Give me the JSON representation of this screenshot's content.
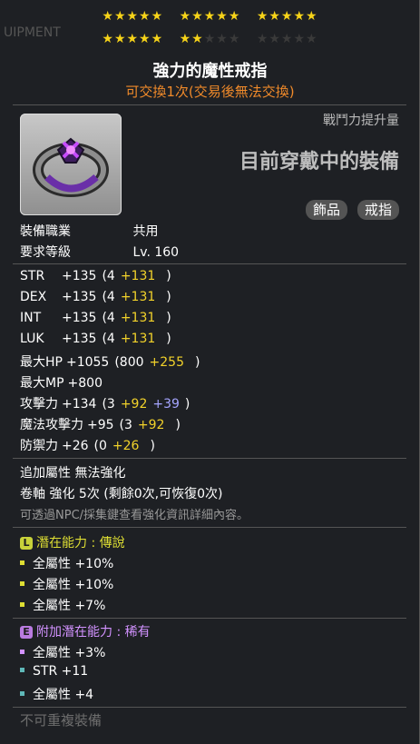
{
  "header": {
    "bg_text": "UIPMENT",
    "stars_row1": [
      "★★★★★",
      "★★★★★",
      "★★★★★"
    ],
    "stars_row2_lit": [
      "★★★★★",
      "★★"
    ],
    "stars_row2_dim": [
      "★★★",
      "★★★★★"
    ],
    "title": "強力的魔性戒指",
    "trade": "可交換1次(交易後無法交換)"
  },
  "item": {
    "icon_name": "ring-icon",
    "combat_label": "戰鬥力提升量",
    "equipped_status": "目前穿戴中的裝備",
    "tags": [
      "飾品",
      "戒指"
    ]
  },
  "requirements": {
    "job_label": "裝備職業",
    "job_value": "共用",
    "level_label": "要求等級",
    "level_value": "Lv. 160"
  },
  "stats": [
    {
      "name": "STR",
      "total": "+135",
      "base": "(4",
      "bonus": "+131",
      "bonus2": "",
      "close": ")"
    },
    {
      "name": "DEX",
      "total": "+135",
      "base": "(4",
      "bonus": "+131",
      "bonus2": "",
      "close": ")"
    },
    {
      "name": "INT",
      "total": "+135",
      "base": "(4",
      "bonus": "+131",
      "bonus2": "",
      "close": ")"
    },
    {
      "name": "LUK",
      "total": "+135",
      "base": "(4",
      "bonus": "+131",
      "bonus2": "",
      "close": ")"
    },
    {
      "name": "最大HP",
      "total": "+1055",
      "base": "(800",
      "bonus": "+255",
      "bonus2": "",
      "close": ")"
    },
    {
      "name": "最大MP",
      "total": "+800",
      "base": "",
      "bonus": "",
      "bonus2": "",
      "close": ""
    },
    {
      "name": "攻擊力",
      "total": "+134",
      "base": "(3",
      "bonus": "+92",
      "bonus2": "+39",
      "close": ")"
    },
    {
      "name": "魔法攻擊力",
      "total": "+95",
      "base": "(3",
      "bonus": "+92",
      "bonus2": "",
      "close": ")"
    },
    {
      "name": "防禦力",
      "total": "+26",
      "base": "(0",
      "bonus": "+26",
      "bonus2": "",
      "close": ")"
    }
  ],
  "enhance": {
    "line1_label": "追加屬性",
    "line1_value": "無法強化",
    "line2_label": "卷軸 強化",
    "line2_value": "5次",
    "line2_detail": "(剩餘0次,可恢復0次)",
    "hint": "可透過NPC/採集鍵查看強化資訊詳細內容。"
  },
  "potential": {
    "badge": "L",
    "title": "潛在能力 : 傳說",
    "lines": [
      "全屬性 +10%",
      "全屬性 +10%",
      "全屬性 +7%"
    ],
    "color": "#dede33"
  },
  "additional": {
    "badge": "E",
    "title": "附加潛在能力 : 稀有",
    "lines": [
      "全屬性 +3%",
      "STR +11",
      "全屬性 +4"
    ],
    "color": "#d292ff"
  },
  "footer": {
    "note": "不可重複裝備"
  }
}
